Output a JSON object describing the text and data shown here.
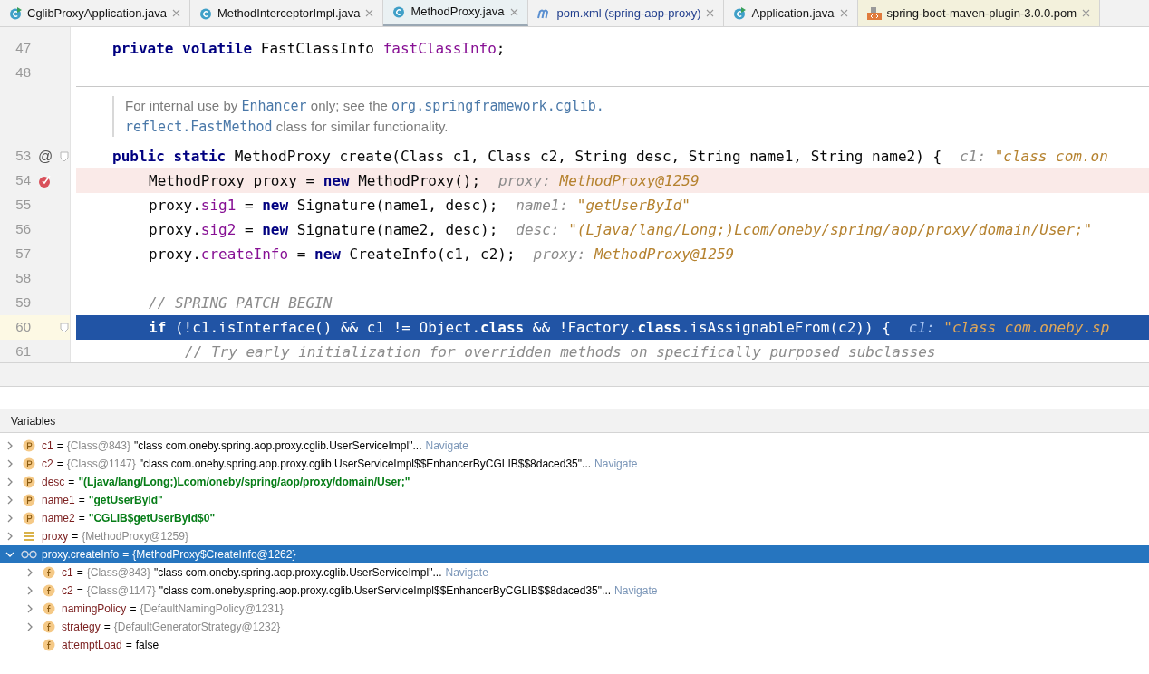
{
  "tabs": [
    {
      "label": "CglibProxyApplication.java",
      "kind": "java-run",
      "selected": false
    },
    {
      "label": "MethodInterceptorImpl.java",
      "kind": "java",
      "selected": false
    },
    {
      "label": "MethodProxy.java",
      "kind": "java",
      "selected": true
    },
    {
      "label": "pom.xml (spring-aop-proxy)",
      "kind": "maven",
      "selected": false
    },
    {
      "label": "Application.java",
      "kind": "java-run",
      "selected": false
    },
    {
      "label": "spring-boot-maven-plugin-3.0.0.pom",
      "kind": "library-pom",
      "selected": false
    }
  ],
  "editor": {
    "lines": [
      {
        "kind": "code",
        "number": "47",
        "breakpoint": false,
        "current": false,
        "foldable": false,
        "segments": [
          {
            "kind": "kw",
            "text": "private volatile"
          },
          {
            "kind": "plain",
            "text": " FastClassInfo "
          },
          {
            "kind": "field",
            "text": "fastClassInfo"
          },
          {
            "kind": "plain",
            "text": ";"
          }
        ]
      },
      {
        "kind": "code",
        "number": "48",
        "breakpoint": false,
        "current": false,
        "foldable": false
      },
      {
        "kind": "doc",
        "segments": [
          {
            "kind": "text",
            "text": "For internal use by "
          },
          {
            "kind": "code",
            "text": "Enhancer"
          },
          {
            "kind": "text",
            "text": " only; see the "
          },
          {
            "kind": "code",
            "text": "org.springframework.cglib."
          }
        ]
      },
      {
        "kind": "doc",
        "segments": [
          {
            "kind": "code",
            "text": "reflect.FastMethod"
          },
          {
            "kind": "text",
            "text": " class for similar functionality."
          }
        ]
      },
      {
        "kind": "code",
        "number": "53",
        "marker": "@",
        "breakpoint": false,
        "current": false,
        "foldable": true,
        "segments": [
          {
            "kind": "kw",
            "text": "public static"
          },
          {
            "kind": "plain",
            "text": " MethodProxy create(Class c1, Class c2, String desc, String name1, String name2) {"
          },
          {
            "kind": "hint_label",
            "text": "c1: "
          },
          {
            "kind": "hint_value",
            "text": "\"class com.on"
          }
        ],
        "children": [
          {
            "kind": "code",
            "number": "54",
            "breakpoint": true,
            "current": false,
            "foldable": false,
            "segments": [
              {
                "kind": "plain",
                "text": "MethodProxy proxy = "
              },
              {
                "kind": "kw",
                "text": "new"
              },
              {
                "kind": "plain",
                "text": " MethodProxy();"
              },
              {
                "kind": "hint_label",
                "text": "proxy: "
              },
              {
                "kind": "hint_value",
                "text": "MethodProxy@1259"
              }
            ]
          },
          {
            "kind": "code",
            "number": "55",
            "breakpoint": false,
            "current": false,
            "foldable": false,
            "segments": [
              {
                "kind": "plain",
                "text": "proxy."
              },
              {
                "kind": "field",
                "text": "sig1"
              },
              {
                "kind": "plain",
                "text": " = "
              },
              {
                "kind": "kw",
                "text": "new"
              },
              {
                "kind": "plain",
                "text": " Signature(name1, desc);"
              },
              {
                "kind": "hint_label",
                "text": "name1: "
              },
              {
                "kind": "hint_value",
                "text": "\"getUserById\""
              }
            ]
          },
          {
            "kind": "code",
            "number": "56",
            "breakpoint": false,
            "current": false,
            "foldable": false,
            "segments": [
              {
                "kind": "plain",
                "text": "proxy."
              },
              {
                "kind": "field",
                "text": "sig2"
              },
              {
                "kind": "plain",
                "text": " = "
              },
              {
                "kind": "kw",
                "text": "new"
              },
              {
                "kind": "plain",
                "text": " Signature(name2, desc);"
              },
              {
                "kind": "hint_label",
                "text": "desc: "
              },
              {
                "kind": "hint_value",
                "text": "\"(Ljava/lang/Long;)Lcom/oneby/spring/aop/proxy/domain/User;\""
              }
            ]
          },
          {
            "kind": "code",
            "number": "57",
            "breakpoint": false,
            "current": false,
            "foldable": false,
            "segments": [
              {
                "kind": "plain",
                "text": "proxy."
              },
              {
                "kind": "field",
                "text": "createInfo"
              },
              {
                "kind": "plain",
                "text": " = "
              },
              {
                "kind": "kw",
                "text": "new"
              },
              {
                "kind": "plain",
                "text": " CreateInfo(c1, c2);"
              },
              {
                "kind": "hint_label",
                "text": "proxy: "
              },
              {
                "kind": "hint_value",
                "text": "MethodProxy@1259"
              }
            ]
          },
          {
            "kind": "code",
            "number": "58",
            "breakpoint": false,
            "current": false,
            "foldable": false
          },
          {
            "kind": "code",
            "number": "59",
            "breakpoint": false,
            "current": false,
            "foldable": false,
            "segments": [
              {
                "kind": "comment",
                "text": "// SPRING PATCH BEGIN"
              }
            ]
          },
          {
            "kind": "code",
            "number": "60",
            "breakpoint": false,
            "current": true,
            "foldable": true,
            "segments": [
              {
                "kind": "kw",
                "text": "if"
              },
              {
                "kind": "plain",
                "text": " (!c1.isInterface() && c1 != Object."
              },
              {
                "kind": "kw",
                "text": "class"
              },
              {
                "kind": "plain",
                "text": " && !Factory."
              },
              {
                "kind": "kw",
                "text": "class"
              },
              {
                "kind": "plain",
                "text": ".isAssignableFrom(c2)) {"
              },
              {
                "kind": "hint_label",
                "text": "c1: "
              },
              {
                "kind": "hint_value",
                "text": "\"class com.oneby.sp"
              }
            ],
            "children": [
              {
                "kind": "code",
                "number": "61",
                "breakpoint": false,
                "current": false,
                "foldable": false,
                "segments": [
                  {
                    "kind": "comment",
                    "text": "// Try early initialization for overridden methods on specifically purposed subclasses"
                  }
                ]
              }
            ]
          }
        ]
      }
    ]
  },
  "variables": {
    "title": "Variables",
    "rows": [
      {
        "kind": "parameter",
        "name": "c1",
        "operator": "=",
        "has_children": true,
        "expanded": false,
        "selected": false,
        "type_ref": "{Class@843}",
        "value": "\"class com.oneby.spring.aop.proxy.cglib.UserServiceImpl\"...",
        "string_value": false,
        "link": "Navigate"
      },
      {
        "kind": "parameter",
        "name": "c2",
        "operator": "=",
        "has_children": true,
        "expanded": false,
        "selected": false,
        "type_ref": "{Class@1147}",
        "value": "\"class com.oneby.spring.aop.proxy.cglib.UserServiceImpl$$EnhancerByCGLIB$$8daced35\"...",
        "string_value": false,
        "link": "Navigate"
      },
      {
        "kind": "parameter",
        "name": "desc",
        "operator": "=",
        "has_children": true,
        "expanded": false,
        "selected": false,
        "value": "\"(Ljava/lang/Long;)Lcom/oneby/spring/aop/proxy/domain/User;\"",
        "string_value": true
      },
      {
        "kind": "parameter",
        "name": "name1",
        "operator": "=",
        "has_children": true,
        "expanded": false,
        "selected": false,
        "value": "\"getUserById\"",
        "string_value": true
      },
      {
        "kind": "parameter",
        "name": "name2",
        "operator": "=",
        "has_children": true,
        "expanded": false,
        "selected": false,
        "value": "\"CGLIB$getUserById$0\"",
        "string_value": true
      },
      {
        "kind": "local",
        "name": "proxy",
        "operator": "=",
        "has_children": true,
        "expanded": false,
        "selected": false,
        "type_ref": "{MethodProxy@1259}"
      },
      {
        "kind": "watch",
        "name": "proxy.createInfo",
        "operator": "=",
        "has_children": true,
        "expanded": true,
        "selected": true,
        "type_ref": "{MethodProxy$CreateInfo@1262}",
        "children": [
          {
            "kind": "field",
            "name": "c1",
            "operator": "=",
            "has_children": true,
            "expanded": false,
            "selected": false,
            "type_ref": "{Class@843}",
            "value": "\"class com.oneby.spring.aop.proxy.cglib.UserServiceImpl\"...",
            "string_value": false,
            "link": "Navigate"
          },
          {
            "kind": "field",
            "name": "c2",
            "operator": "=",
            "has_children": true,
            "expanded": false,
            "selected": false,
            "type_ref": "{Class@1147}",
            "value": "\"class com.oneby.spring.aop.proxy.cglib.UserServiceImpl$$EnhancerByCGLIB$$8daced35\"...",
            "string_value": false,
            "link": "Navigate"
          },
          {
            "kind": "field",
            "name": "namingPolicy",
            "operator": "=",
            "has_children": true,
            "expanded": false,
            "selected": false,
            "type_ref": "{DefaultNamingPolicy@1231}"
          },
          {
            "kind": "field",
            "name": "strategy",
            "operator": "=",
            "has_children": true,
            "expanded": false,
            "selected": false,
            "type_ref": "{DefaultGeneratorStrategy@1232}"
          },
          {
            "kind": "field",
            "name": "attemptLoad",
            "has_children": false,
            "expanded": false,
            "selected": false,
            "operator": "=",
            "value": "false",
            "string_value": false
          }
        ]
      }
    ]
  }
}
